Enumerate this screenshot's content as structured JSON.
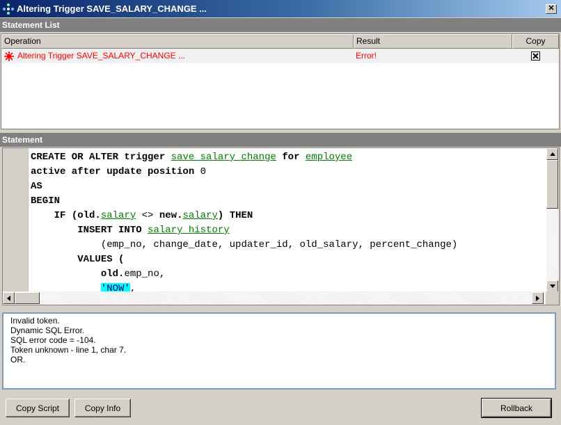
{
  "window": {
    "title": "Altering Trigger SAVE_SALARY_CHANGE ...",
    "close_glyph": "✕"
  },
  "statement_list": {
    "header": "Statement List",
    "columns": [
      "Operation",
      "Result",
      "Copy"
    ],
    "rows": [
      {
        "operation": "Altering Trigger SAVE_SALARY_CHANGE ...",
        "result": "Error!",
        "copy_checked": true,
        "icon": "error-icon",
        "color": "#ff0000"
      }
    ]
  },
  "statement": {
    "header": "Statement",
    "lines": [
      [
        [
          "kw",
          "CREATE OR ALTER trigger "
        ],
        [
          "id",
          "save salary change"
        ],
        [
          "kw",
          " for "
        ],
        [
          "id",
          "employee"
        ]
      ],
      [
        [
          "kw",
          "active after update position "
        ],
        [
          "t",
          "0"
        ]
      ],
      [
        [
          "kw",
          "AS"
        ]
      ],
      [
        [
          "kw",
          "BEGIN"
        ]
      ],
      [
        [
          "t",
          "    "
        ],
        [
          "kw",
          "IF ("
        ],
        [
          "kw",
          "old."
        ],
        [
          "id",
          "salary"
        ],
        [
          "t",
          " <> "
        ],
        [
          "kw",
          "new."
        ],
        [
          "id",
          "salary"
        ],
        [
          "kw",
          ") THEN"
        ]
      ],
      [
        [
          "t",
          "        "
        ],
        [
          "kw",
          "INSERT INTO "
        ],
        [
          "id",
          "salary history"
        ]
      ],
      [
        [
          "t",
          "            (emp_no, change_date, updater_id, old_salary, percent_change)"
        ]
      ],
      [
        [
          "t",
          "        "
        ],
        [
          "kw",
          "VALUES ("
        ]
      ],
      [
        [
          "t",
          "            "
        ],
        [
          "kw",
          "old."
        ],
        [
          "t",
          "emp_no,"
        ]
      ],
      [
        [
          "t",
          "            "
        ],
        [
          "str",
          "'NOW'"
        ],
        [
          "t",
          ","
        ]
      ]
    ]
  },
  "messages": {
    "lines": [
      "Invalid token.",
      "Dynamic SQL Error.",
      "SQL error code = -104.",
      "Token unknown - line 1, char 7.",
      "OR."
    ]
  },
  "buttons": {
    "copy_script": "Copy Script",
    "copy_info": "Copy Info",
    "rollback": "Rollback"
  },
  "colors": {
    "title_gradient_start": "#0a246a",
    "error_text": "#ff0000",
    "identifier": "#008000",
    "string_highlight": "#00ffff",
    "panel": "#d4d0c8"
  }
}
